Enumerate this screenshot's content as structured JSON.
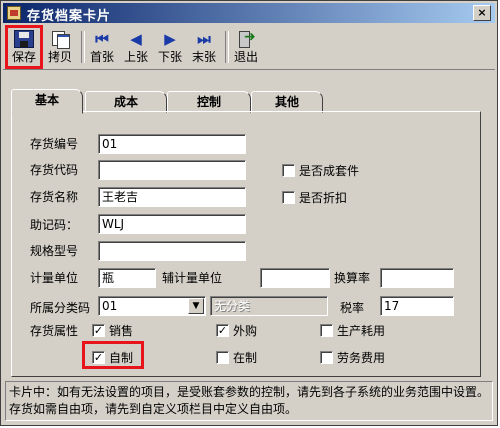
{
  "window": {
    "title": "存货档案卡片",
    "close_glyph": "×"
  },
  "toolbar": {
    "buttons": [
      {
        "label": "保存",
        "icon": "save-icon"
      },
      {
        "label": "拷贝",
        "icon": "copy-icon"
      },
      {
        "label": "首张",
        "icon": "first-record-icon",
        "glyph": "⏮"
      },
      {
        "label": "上张",
        "icon": "previous-record-icon",
        "glyph": "◀"
      },
      {
        "label": "下张",
        "icon": "next-record-icon",
        "glyph": "▶"
      },
      {
        "label": "末张",
        "icon": "last-record-icon",
        "glyph": "⏭"
      },
      {
        "label": "退出",
        "icon": "exit-icon"
      }
    ]
  },
  "tabs": [
    {
      "label": "基本",
      "active": true
    },
    {
      "label": "成本",
      "active": false
    },
    {
      "label": "控制",
      "active": false
    },
    {
      "label": "其他",
      "active": false
    }
  ],
  "form": {
    "code": {
      "label": "存货编号",
      "value": "01"
    },
    "alt_code": {
      "label": "存货代码",
      "value": ""
    },
    "name": {
      "label": "存货名称",
      "value": "王老吉"
    },
    "mnemonic": {
      "label": "助记码：",
      "value": "WLJ"
    },
    "spec": {
      "label": "规格型号",
      "value": ""
    },
    "unit": {
      "label": "计量单位",
      "value": "瓶"
    },
    "aux_unit": {
      "label": "辅计量单位",
      "value": ""
    },
    "conversion_rate": {
      "label": "换算率",
      "value": ""
    },
    "category": {
      "label": "所属分类码",
      "value": "01",
      "name_value": "无分类",
      "button_glyph": "▼"
    },
    "tax_rate": {
      "label": "税率",
      "value": "17"
    },
    "attributes_label": "存货属性",
    "is_kit": {
      "label": "是否成套件",
      "checked": false
    },
    "is_discount": {
      "label": "是否折扣",
      "checked": false
    },
    "attributes": [
      {
        "key": "sales",
        "label": "销售",
        "checked": true
      },
      {
        "key": "purchase",
        "label": "外购",
        "checked": true
      },
      {
        "key": "production_consume",
        "label": "生产耗用",
        "checked": false
      },
      {
        "key": "self_made",
        "label": "自制",
        "checked": true
      },
      {
        "key": "in_process",
        "label": "在制",
        "checked": false
      },
      {
        "key": "service_fee",
        "label": "劳务费用",
        "checked": false
      }
    ],
    "check_glyph": "✓"
  },
  "footer": {
    "note": "卡片中：如有无法设置的项目，是受账套参数的控制，请先到各子系统的业务范围中设置。存货如需自由项，请先到自定义项栏目中定义自由项。"
  },
  "colors": {
    "highlight": "#e8141c",
    "titlebar_start": "#0a246a",
    "face": "#d4d0c8"
  }
}
